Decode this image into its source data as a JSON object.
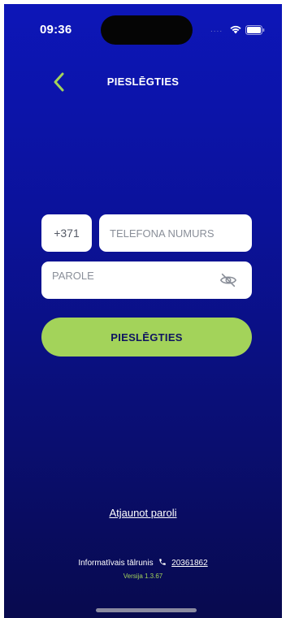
{
  "status_bar": {
    "time": "09:36",
    "signal_dots": "....",
    "icons": [
      "wifi-icon",
      "battery-icon"
    ]
  },
  "header": {
    "back_icon": "chevron-left-icon",
    "title": "PIESLĒGTIES"
  },
  "form": {
    "country_code": "+371",
    "phone_placeholder": "TELEFONA NUMURS",
    "phone_value": "",
    "password_placeholder": "PAROLE",
    "password_value": "",
    "password_toggle_icon": "eye-off-icon",
    "submit_label": "PIESLĒGTIES"
  },
  "links": {
    "reset_password": "Atjaunot paroli"
  },
  "footer": {
    "hotline_label": "Informatīvais tālrunis",
    "hotline_icon": "phone-icon",
    "hotline_number": "20361862",
    "version": "Versija 1.3.67"
  },
  "colors": {
    "background_top": "#0d16b8",
    "background_bottom": "#080a4e",
    "accent": "#a3d35a",
    "text": "#ffffff"
  }
}
